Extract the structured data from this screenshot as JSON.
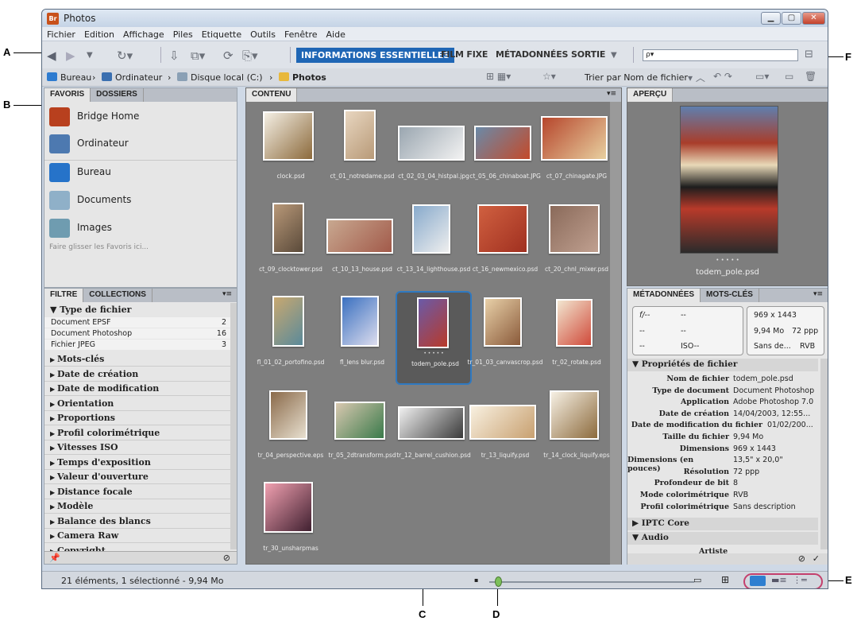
{
  "window_title": "Photos",
  "app_icon": "Br",
  "menu": [
    "Fichier",
    "Edition",
    "Affichage",
    "Piles",
    "Etiquette",
    "Outils",
    "Fenêtre",
    "Aide"
  ],
  "workspaces": {
    "active": "INFORMATIONS ESSENTIELLES",
    "others": [
      "FILM FIXE",
      "MÉTADONNÉES",
      "SORTIE"
    ]
  },
  "search": {
    "value": "ρ▾"
  },
  "breadcrumb": [
    "Bureau",
    "Ordinateur",
    "Disque local (C:)",
    "Photos"
  ],
  "sort_label": "Trier par Nom de fichier",
  "favorites": {
    "tabs": [
      "FAVORIS",
      "DOSSIERS"
    ],
    "items": [
      "Bridge Home",
      "Ordinateur",
      "Bureau",
      "Documents",
      "Images"
    ],
    "hint": "Faire glisser les Favoris ici..."
  },
  "filter": {
    "tabs": [
      "FILTRE",
      "COLLECTIONS"
    ],
    "filetype_header": "Type de fichier",
    "filetypes": [
      {
        "name": "Document EPSF",
        "count": "2"
      },
      {
        "name": "Document Photoshop",
        "count": "16"
      },
      {
        "name": "Fichier JPEG",
        "count": "3"
      }
    ],
    "categories": [
      "Mots-clés",
      "Date de création",
      "Date de modification",
      "Orientation",
      "Proportions",
      "Profil colorimétrique",
      "Vitesses ISO",
      "Temps d'exposition",
      "Valeur d'ouverture",
      "Distance focale",
      "Modèle",
      "Balance des blancs",
      "Camera Raw",
      "Copyright"
    ]
  },
  "content_tab": "CONTENU",
  "files": [
    "clock.psd",
    "ct_01_notredame.psd",
    "ct_02_03_04_histpal.jpg",
    "ct_05_06_chinaboat.JPG",
    "ct_07_chinagate.JPG",
    "ct_09_clocktower.psd",
    "ct_10_13_house.psd",
    "ct_13_14_lighthouse.psd",
    "ct_16_newmexico.psd",
    "ct_20_chnl_mixer.psd",
    "fl_01_02_portofino.psd",
    "fl_lens blur.psd",
    "todem_pole.psd",
    "tr_01_03_canvascrop.psd",
    "tr_02_rotate.psd",
    "tr_04_perspective.eps",
    "tr_05_2dtransform.psd",
    "tr_12_barrel_cushion.psd",
    "tr_13_liquify.psd",
    "tr_14_clock_liquify.eps",
    "tr_30_unsharpmas"
  ],
  "preview": {
    "tab": "APERÇU",
    "caption": "todem_pole.psd",
    "dots": "• • • • •"
  },
  "metadata": {
    "tabs": [
      "MÉTADONNÉES",
      "MOTS-CLÉS"
    ],
    "camera": {
      "aperture": "f/--",
      "shutter": "--",
      "c1": "--",
      "c2": "--",
      "c3": "--",
      "iso": "ISO--"
    },
    "summary": {
      "dims": "969 x 1443",
      "size": "9,94 Mo",
      "res": "72 ppp",
      "profile": "Sans de...",
      "mode": "RVB"
    },
    "section": "Propriétés de fichier",
    "props": [
      {
        "k": "Nom de fichier",
        "v": "todem_pole.psd"
      },
      {
        "k": "Type de document",
        "v": "Document Photoshop"
      },
      {
        "k": "Application",
        "v": "Adobe Photoshop 7.0"
      },
      {
        "k": "Date de création",
        "v": "14/04/2003, 12:55..."
      },
      {
        "k": "Date de modification du fichier",
        "v": "01/02/200..."
      },
      {
        "k": "Taille du fichier",
        "v": "9,94 Mo"
      },
      {
        "k": "Dimensions",
        "v": "969 x 1443"
      },
      {
        "k": "Dimensions (en pouces)",
        "v": "13,5\" x 20,0\""
      },
      {
        "k": "Résolution",
        "v": "72 ppp"
      },
      {
        "k": "Profondeur de bit",
        "v": "8"
      },
      {
        "k": "Mode colorimétrique",
        "v": "RVB"
      },
      {
        "k": "Profil colorimétrique",
        "v": "Sans description"
      }
    ],
    "sections2": [
      "IPTC Core",
      "Audio"
    ],
    "audio_row": "Artiste"
  },
  "status": "21 éléments, 1 sélectionné - 9,94 Mo",
  "callouts": [
    "A",
    "B",
    "C",
    "D",
    "E",
    "F"
  ]
}
